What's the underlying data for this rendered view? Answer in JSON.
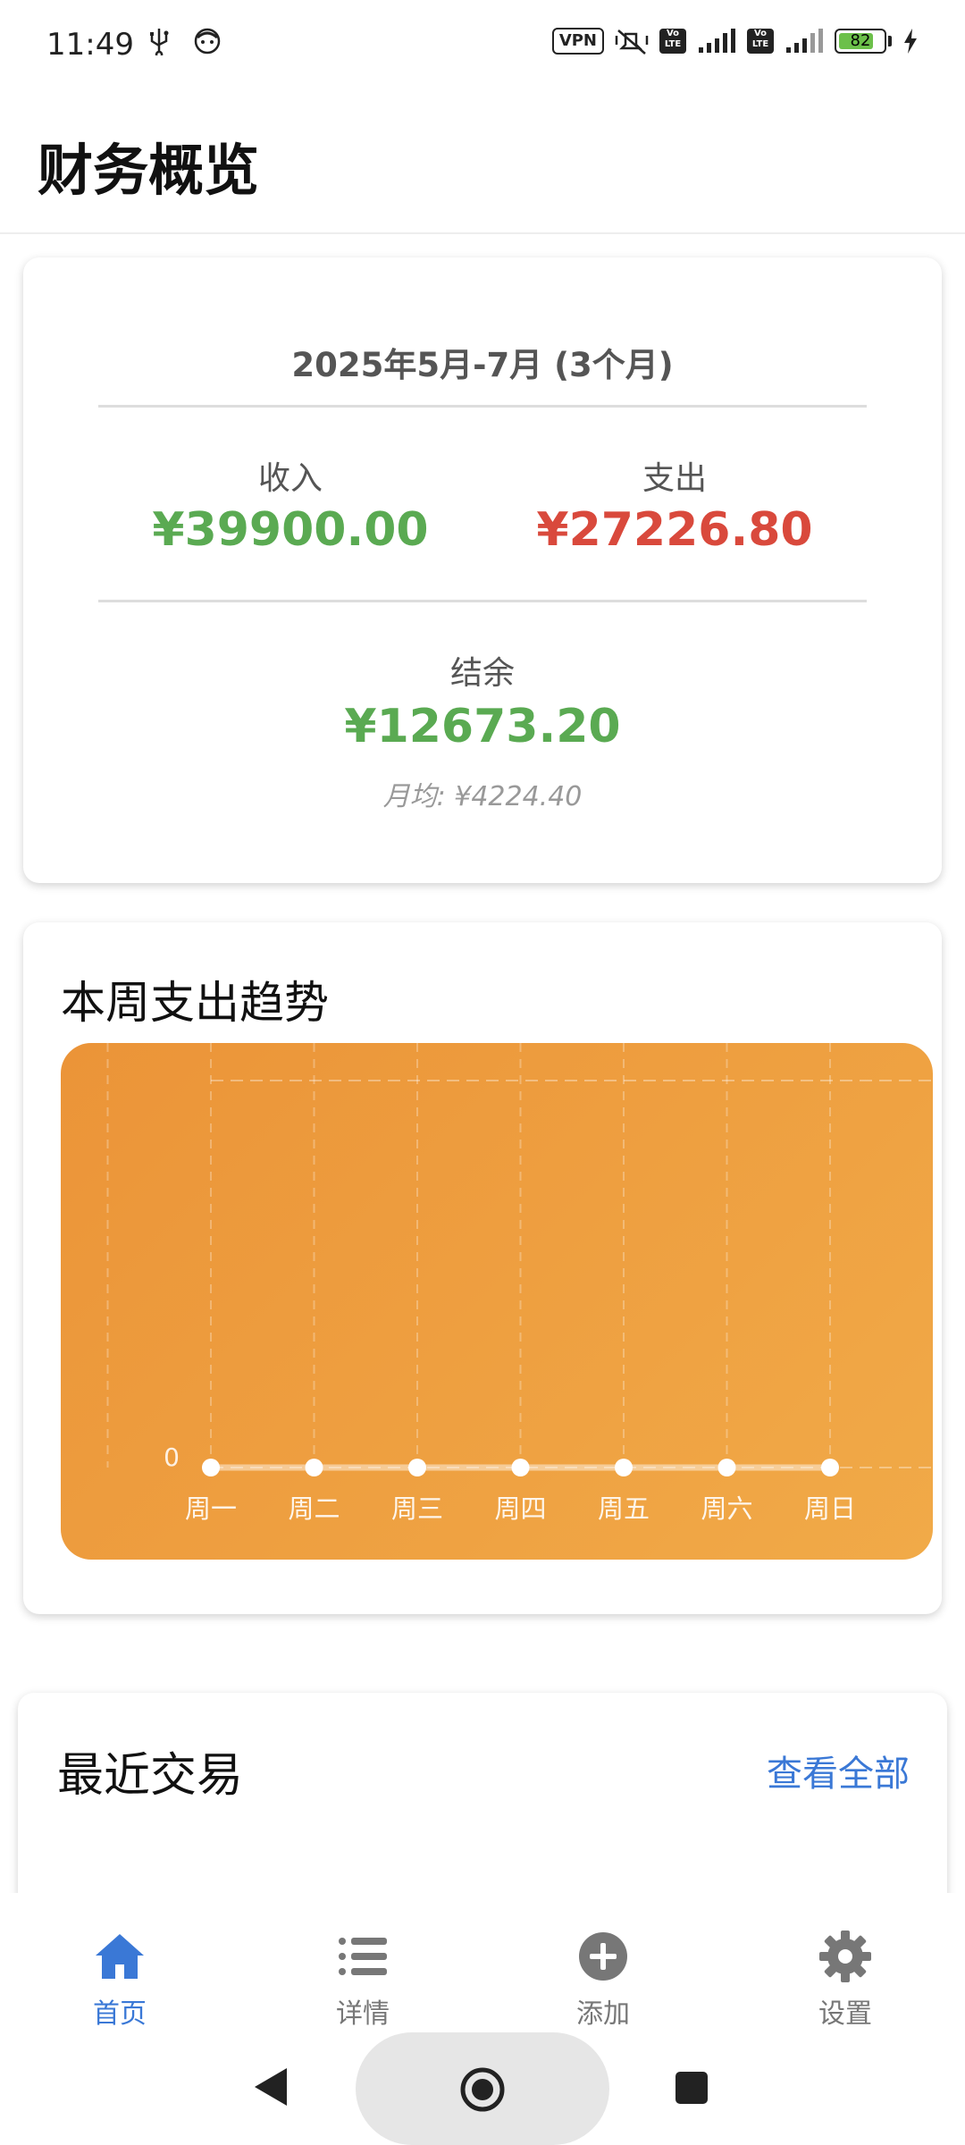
{
  "status_bar": {
    "time": "11:49",
    "icons": [
      "usb-icon",
      "face-icon",
      "vpn-icon",
      "mute-icon",
      "volte-icon",
      "signal-icon",
      "volte-icon",
      "signal-icon",
      "battery-icon",
      "charging-icon"
    ],
    "vpn": "VPN",
    "volte": "Vo LTE",
    "battery_level": "82",
    "battery_fraction": 0.82
  },
  "header": {
    "title": "财务概览"
  },
  "overview": {
    "period": "2025年5月-7月 (3个月)",
    "income_label": "收入",
    "income_value": "¥39900.00",
    "expense_label": "支出",
    "expense_value": "¥27226.80",
    "balance_label": "结余",
    "balance_value": "¥12673.20",
    "monthly_avg": "月均: ¥4224.40",
    "colors": {
      "income": "#5aaa52",
      "expense": "#d9493c",
      "balance": "#5aaa52"
    }
  },
  "trend": {
    "title": "本周支出趋势"
  },
  "chart_data": {
    "type": "line",
    "categories": [
      "周一",
      "周二",
      "周三",
      "周四",
      "周五",
      "周六",
      "周日"
    ],
    "values": [
      0,
      0,
      0,
      0,
      0,
      0,
      0
    ],
    "y_ticks": [
      "0"
    ],
    "grid": true,
    "colors": {
      "background_start": "#eb9438",
      "background_end": "#f1aa48",
      "line": "#ffffff"
    }
  },
  "recent": {
    "title": "最近交易",
    "view_all": "查看全部"
  },
  "bottom_nav": {
    "items": [
      {
        "label": "首页",
        "icon": "home-icon",
        "active": true
      },
      {
        "label": "详情",
        "icon": "list-icon",
        "active": false
      },
      {
        "label": "添加",
        "icon": "add-icon",
        "active": false
      },
      {
        "label": "设置",
        "icon": "gear-icon",
        "active": false
      }
    ],
    "active_color": "#3a78d6",
    "inactive_color": "#777777"
  },
  "system_nav": {
    "icons": [
      "back-icon",
      "home-button-icon",
      "recents-icon"
    ]
  }
}
